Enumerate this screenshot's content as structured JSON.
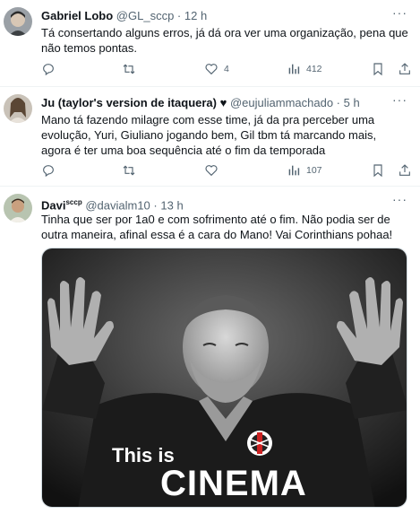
{
  "tweets": [
    {
      "name": "Gabriel Lobo",
      "handle": "@GL_sccp",
      "dot": "·",
      "time": "12 h",
      "text": "Tá consertando alguns erros, já dá ora ver uma organização, pena que não temos pontas.",
      "likes": "4",
      "views": "412"
    },
    {
      "name": "Ju (taylor's version de itaquera)",
      "handle": "@eujuliammachado",
      "dot": "·",
      "time": "5 h",
      "text": "Mano tá fazendo milagre com esse time, já da pra perceber uma evolução, Yuri, Giuliano jogando bem, Gil tbm tá marcando mais, agora é ter uma boa sequência até o fim da temporada",
      "likes": "",
      "views": "107"
    },
    {
      "name": "Davi",
      "name_sup": "sccp",
      "handle": "@davialm10",
      "dot": "·",
      "time": "13 h",
      "text": "Tinha que ser por 1a0 e com sofrimento até o fim. Não podia ser de outra maneira, afinal essa é a cara do Mano! Vai Corinthians pohaa!",
      "media_text_1": "This is",
      "media_text_2": "CINEMA"
    }
  ],
  "more_label": "···"
}
